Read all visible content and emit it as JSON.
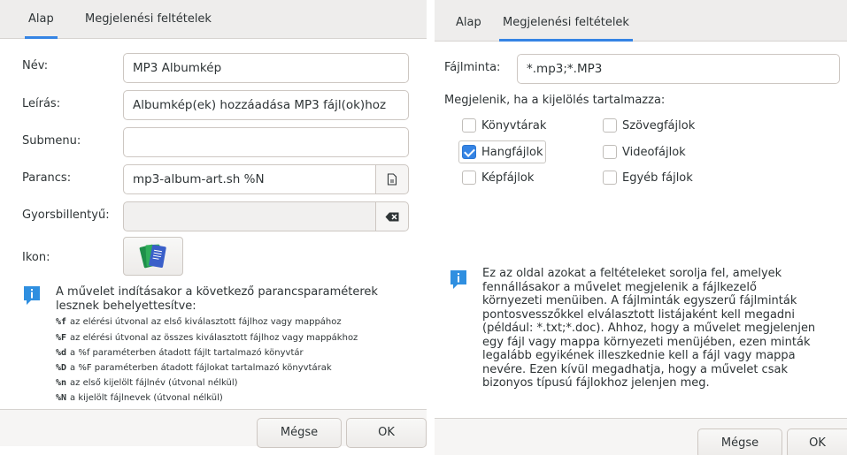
{
  "left": {
    "tabs": [
      {
        "label": "Alap",
        "active": true
      },
      {
        "label": "Megjelenési feltételek",
        "active": false
      }
    ],
    "fields": {
      "name_label": "Név:",
      "name_value": "MP3 Albumkép",
      "description_label": "Leírás:",
      "description_value": "Albumkép(ek) hozzáadása MP3 fájl(ok)hoz",
      "submenu_label": "Submenu:",
      "submenu_value": "",
      "command_label": "Parancs:",
      "command_value": "mp3-album-art.sh  %N",
      "shortcut_label": "Gyorsbillentyű:",
      "shortcut_value": "",
      "icon_label": "Ikon:"
    },
    "help": {
      "intro_line1": "A művelet indításakor a következő parancsparaméterek",
      "intro_line2": "lesznek behelyettesítve:",
      "params": [
        {
          "code": "%f",
          "text": "az elérési útvonal az első kiválasztott fájlhoz vagy mappához"
        },
        {
          "code": "%F",
          "text": "az elérési útvonal az összes kiválasztott fájlhoz vagy mappákhoz"
        },
        {
          "code": "%d",
          "text": "a %f paraméterben átadott fájlt tartalmazó könyvtár"
        },
        {
          "code": "%D",
          "text": "a %F paraméterben átadott fájlokat tartalmazó könyvtárak"
        },
        {
          "code": "%n",
          "text": "az első kijelölt fájlnév (útvonal nélkül)"
        },
        {
          "code": "%N",
          "text": "a kijelölt fájlnevek (útvonal nélkül)"
        }
      ]
    },
    "buttons": {
      "cancel": "Mégse",
      "ok": "OK"
    }
  },
  "right": {
    "tabs": [
      {
        "label": "Alap",
        "active": false
      },
      {
        "label": "Megjelenési feltételek",
        "active": true
      }
    ],
    "pattern_label": "Fájlminta:",
    "pattern_value": "*.mp3;*.MP3",
    "appears_label": "Megjelenik, ha a kijelölés tartalmazza:",
    "checks": [
      {
        "label": "Könyvtárak",
        "checked": false
      },
      {
        "label": "Szövegfájlok",
        "checked": false
      },
      {
        "label": "Hangfájlok",
        "checked": true
      },
      {
        "label": "Videofájlok",
        "checked": false
      },
      {
        "label": "Képfájlok",
        "checked": false
      },
      {
        "label": "Egyéb fájlok",
        "checked": false
      }
    ],
    "info_lines": [
      "Ez az oldal azokat a feltételeket sorolja fel, amelyek",
      "fennállásakor a művelet megjelenik a fájlkezelő",
      "környezeti menüiben. A fájlminták egyszerű fájlminták",
      "pontosvesszőkkel elválasztott listájaként kell megadni",
      "(például: *.txt;*.doc). Ahhoz, hogy a művelet megjelenjen",
      "egy fájl vagy mappa környezeti menüjében, ezen minták",
      "legalább egyikének illeszkednie kell a fájl vagy mappa",
      "nevére. Ezen kívül megadhatja, hogy a művelet csak",
      "bizonyos típusú fájlokhoz jelenjen meg."
    ],
    "buttons": {
      "cancel": "Mégse",
      "ok": "OK"
    }
  },
  "colors": {
    "accent": "#3584e4",
    "info_icon": "#2f8fe0",
    "icon_green": "#2fae5a"
  },
  "icons": {
    "file_chooser": "document-open-icon",
    "clear": "backspace-clear-icon",
    "info": "info-icon"
  }
}
